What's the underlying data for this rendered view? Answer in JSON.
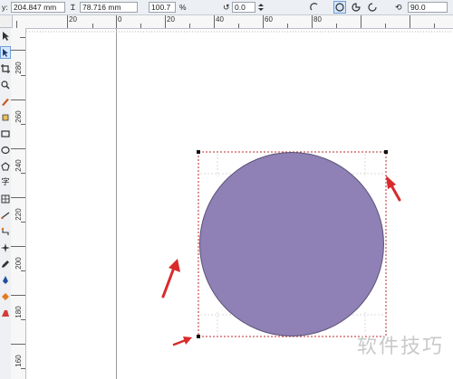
{
  "property_bar": {
    "y_label": "y:",
    "y_value": "204.847 mm",
    "height_value": "78.716 mm",
    "scale_value": "100.7",
    "scale_unit": "%",
    "rotation_value": "0.0",
    "angle_value": "90.0"
  },
  "ruler": {
    "horizontal": [
      "20",
      "0",
      "20",
      "40",
      "60",
      "80"
    ],
    "vertical": [
      "280",
      "260",
      "240",
      "220",
      "200",
      "180",
      "160"
    ]
  },
  "toolbox": {
    "icons": [
      "pick-tool-icon",
      "shape-tool-icon",
      "crop-tool-icon",
      "zoom-tool-icon",
      "freehand-tool-icon",
      "smart-fill-icon",
      "rectangle-tool-icon",
      "ellipse-tool-icon",
      "polygon-tool-icon",
      "text-tool-icon",
      "table-tool-icon",
      "dimension-tool-icon",
      "connector-tool-icon",
      "effects-tool-icon",
      "eyedropper-tool-icon",
      "outline-pen-icon",
      "fill-tool-icon",
      "interactive-fill-icon"
    ],
    "text_tool_glyph": "字"
  },
  "shape": {
    "fill_color": "#8f80b5",
    "outline_color": "#5b5478",
    "selection_color": "#c2282d"
  },
  "annotations": {
    "arrow_color": "#d92b2b"
  },
  "watermark": "软件技巧"
}
